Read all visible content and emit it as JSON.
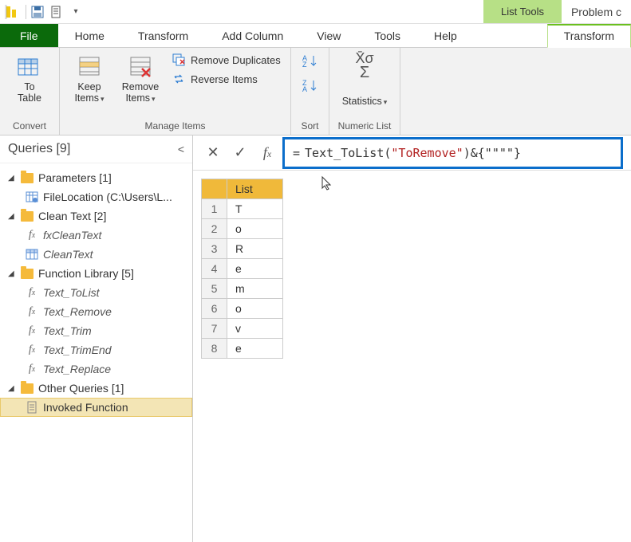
{
  "titlebar": {
    "context_tab": "List Tools",
    "doc_title": "Problem c"
  },
  "tabs": {
    "file": "File",
    "home": "Home",
    "transform1": "Transform",
    "addcol": "Add Column",
    "view": "View",
    "tools": "Tools",
    "help": "Help",
    "transform2": "Transform"
  },
  "ribbon": {
    "convert": {
      "to_table": "To\nTable",
      "label": "Convert"
    },
    "manage": {
      "keep": "Keep\nItems",
      "remove": "Remove\nItems",
      "remove_dup": "Remove Duplicates",
      "reverse": "Reverse Items",
      "label": "Manage Items"
    },
    "sort": {
      "label": "Sort"
    },
    "numeric": {
      "stats": "Statistics",
      "label": "Numeric List"
    }
  },
  "sidebar": {
    "title": "Queries [9]",
    "groups": [
      {
        "label": "Parameters [1]",
        "items": [
          {
            "label": "FileLocation (C:\\Users\\L...",
            "icon": "param",
            "italic": false
          }
        ]
      },
      {
        "label": "Clean Text [2]",
        "items": [
          {
            "label": "fxCleanText",
            "icon": "fx",
            "italic": true
          },
          {
            "label": "CleanText",
            "icon": "table",
            "italic": true
          }
        ]
      },
      {
        "label": "Function Library [5]",
        "items": [
          {
            "label": "Text_ToList",
            "icon": "fx",
            "italic": true
          },
          {
            "label": "Text_Remove",
            "icon": "fx",
            "italic": true
          },
          {
            "label": "Text_Trim",
            "icon": "fx",
            "italic": true
          },
          {
            "label": "Text_TrimEnd",
            "icon": "fx",
            "italic": true
          },
          {
            "label": "Text_Replace",
            "icon": "fx",
            "italic": true
          }
        ]
      },
      {
        "label": "Other Queries [1]",
        "items": [
          {
            "label": "Invoked Function",
            "icon": "list",
            "italic": false,
            "selected": true
          }
        ]
      }
    ]
  },
  "formula": {
    "prefix": "= ",
    "fn": "Text_ToList",
    "open": "(",
    "arg": "\"ToRemove\"",
    "close": ")",
    "amp": " & ",
    "tail": "{\"\"\"\"}"
  },
  "grid": {
    "header": "List",
    "rows": [
      "T",
      "o",
      "R",
      "e",
      "m",
      "o",
      "v",
      "e"
    ]
  }
}
